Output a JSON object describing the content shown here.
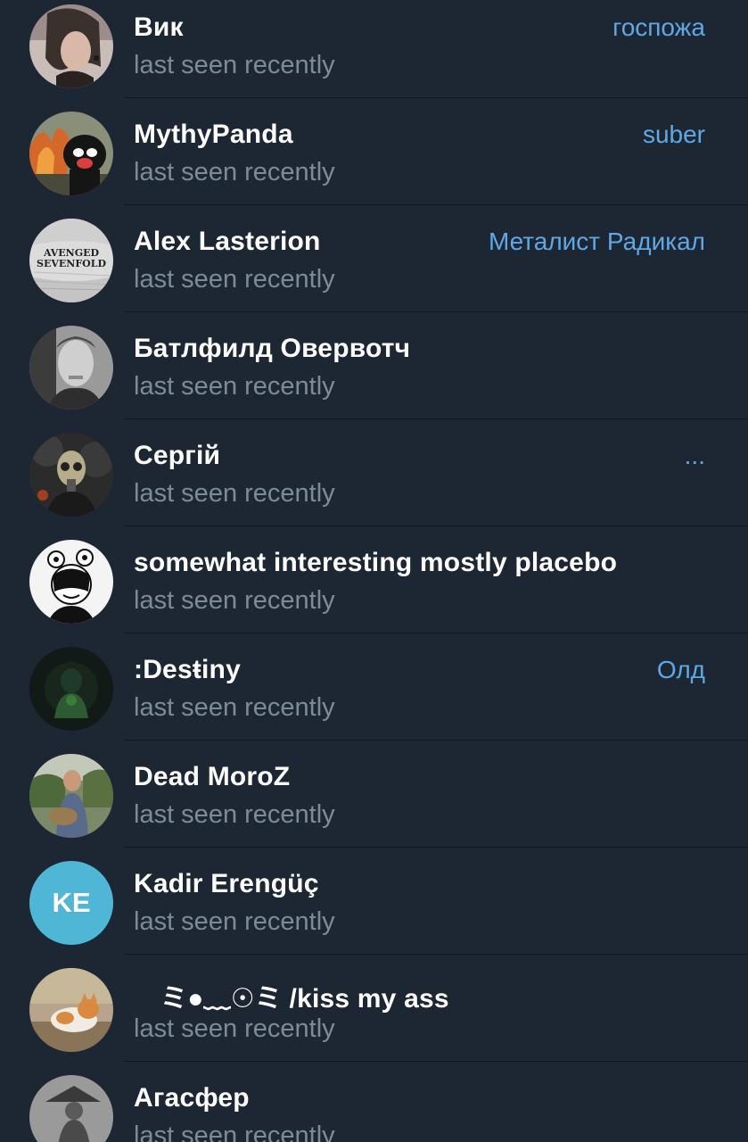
{
  "contacts": [
    {
      "name": "Вик",
      "status": "last seen recently",
      "role": "госпожа",
      "avatar_icon": "photo-woman-portrait",
      "avatar_color": "#8a7a78"
    },
    {
      "name": "MythyPanda",
      "status": "last seen recently",
      "role": "suber",
      "avatar_icon": "photo-bear-fire",
      "avatar_color": "#6b5a4a"
    },
    {
      "name": "Alex Lasterion",
      "status": "last seen recently",
      "role": "Металист Радикал",
      "avatar_icon": "avenged-sevenfold-logo",
      "avatar_color": "#d8d8d8"
    },
    {
      "name": "Батлфилд Овервотч",
      "status": "last seen recently",
      "role": "",
      "avatar_icon": "photo-man-bw",
      "avatar_color": "#707070"
    },
    {
      "name": "Сергій",
      "status": "last seen recently",
      "role": "...",
      "avatar_icon": "gas-mask-icon",
      "avatar_color": "#2a2a2a"
    },
    {
      "name": "somewhat interesting mostly placebo",
      "status": "last seen recently",
      "role": "",
      "avatar_icon": "cartoon-drawing",
      "avatar_color": "#ffffff"
    },
    {
      "name": ":Desŧiny",
      "status": "last seen recently",
      "role": "Олд",
      "avatar_icon": "dark-green-figure",
      "avatar_color": "#16201a"
    },
    {
      "name": "Dead MoroZ",
      "status": "last seen recently",
      "role": "",
      "avatar_icon": "photo-man-outdoors",
      "avatar_color": "#6f7a55"
    },
    {
      "name": "Kadir Erengüç",
      "status": "last seen recently",
      "role": "",
      "avatar_initials": "KE",
      "avatar_icon": "initials-avatar",
      "avatar_color": "#4fb6d6"
    },
    {
      "name": "ミ●﹏☉ミ /kiss my ass",
      "status": "last seen recently",
      "role": "",
      "avatar_icon": "photo-cat",
      "avatar_color": "#a08a70"
    },
    {
      "name": "Агасфер",
      "status": "last seen recently",
      "role": "",
      "avatar_icon": "photo-figure-hat",
      "avatar_color": "#8c8c8c"
    }
  ]
}
